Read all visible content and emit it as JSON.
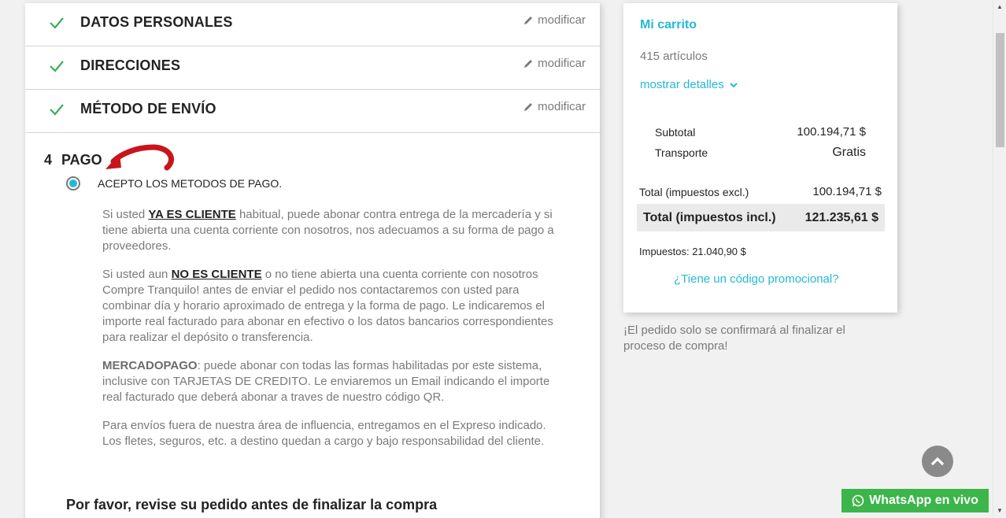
{
  "steps": [
    {
      "title": "DATOS PERSONALES",
      "edit": "modificar"
    },
    {
      "title": "DIRECCIONES",
      "edit": "modificar"
    },
    {
      "title": "MÉTODO DE ENVÍO",
      "edit": "modificar"
    }
  ],
  "payment": {
    "number": "4",
    "title": "PAGO",
    "option_label": "ACEPTO LOS METODOS DE PAGO.",
    "p1_a": "Si usted ",
    "p1_b": "YA ES CLIENTE",
    "p1_c": " habitual, puede abonar contra entrega de la mercadería y si tiene abierta una cuenta corriente con nosotros, nos adecuamos a su forma de pago a proveedores.",
    "p2_a": "Si usted aun ",
    "p2_b": "NO ES CLIENTE",
    "p2_c": " o no tiene abierta una cuenta corriente con nosotros Compre Tranquilo! antes de enviar el pedido nos contactaremos con usted para combinar día y horario aproximado de entrega y la forma de pago. Le indicaremos el importe real facturado para abonar en efectivo o los datos bancarios correspondientes para realizar el depósito o transferencia.",
    "p3_a": "MERCADOPAGO",
    "p3_b": ": puede abonar con todas las formas habilitadas por este sistema, inclusive con TARJETAS DE CREDITO. Le enviaremos un Email indicando el importe real facturado que deberá abonar a traves de nuestro código QR.",
    "p4": "Para envíos fuera de nuestra área de influencia, entregamos en el Expreso indicado. Los fletes, seguros, etc. a destino quedan a cargo y bajo responsabilidad del cliente.",
    "review": "Por favor, revise su pedido antes de finalizar la compra"
  },
  "cart": {
    "title": "Mi carrito",
    "count": "415 artículos",
    "details": "mostrar detalles",
    "subtotal_label": "Subtotal",
    "subtotal_value": "100.194,71 $",
    "shipping_label": "Transporte",
    "shipping_value": "Gratis",
    "total_excl_label": "Total (impuestos excl.)",
    "total_excl_value": "100.194,71 $",
    "total_incl_label": "Total (impuestos incl.)",
    "total_incl_value": "121.235,61 $",
    "taxes": "Impuestos: 21.040,90 $",
    "promo": "¿Tiene un código promocional?"
  },
  "notice": "¡El pedido solo se confirmará al finalizar el proceso de compra!",
  "whatsapp": "WhatsApp en vivo",
  "colors": {
    "accent": "#24b9d7",
    "check": "#3aae5a",
    "arrow": "#c8151b",
    "whatsapp": "#3cb54a"
  }
}
